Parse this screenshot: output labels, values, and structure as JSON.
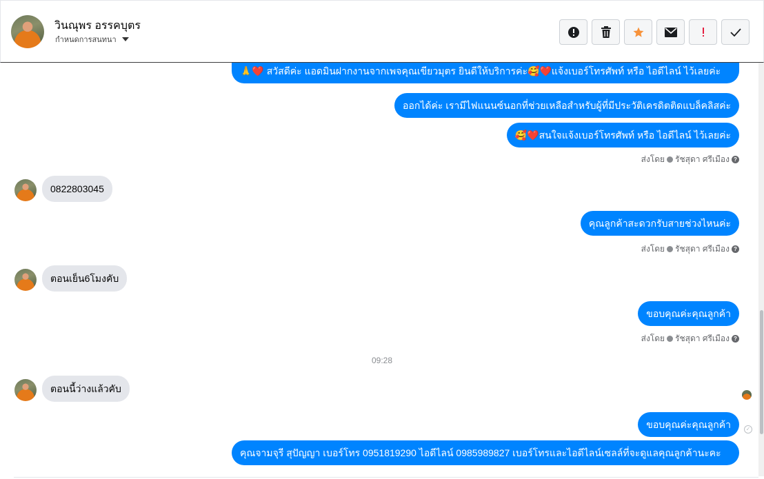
{
  "header": {
    "contact_name": "วินณุพร อรรคบุตร",
    "status_label": "กำหนดการสนทนา",
    "toolbar": [
      {
        "name": "report-button",
        "icon": "exclamation-circle-icon"
      },
      {
        "name": "delete-button",
        "icon": "trash-icon"
      },
      {
        "name": "star-button",
        "icon": "star-icon",
        "color": "#f7923a"
      },
      {
        "name": "email-button",
        "icon": "envelope-icon"
      },
      {
        "name": "important-button",
        "icon": "exclamation-icon",
        "color": "#e41e3f"
      },
      {
        "name": "done-button",
        "icon": "checkmark-icon"
      }
    ]
  },
  "messages": {
    "out_1": "🙏❤️ สวัสดีค่ะ แอดมินฝากงานจากเพจคุณเขียวมุตร ยินดีให้บริการค่ะ🥰❤️แจ้งเบอร์โทรศัพท์ หรือ ไอดีไลน์ ไว้เลยค่ะ",
    "out_2": "ออกได้ค่ะ เรามีไฟแนนซ์นอกที่ช่วยเหลือสำหรับผู้ที่มีประวัติเครดิตติดแบล็คลิสค่ะ",
    "out_3": "🥰❤️สนใจแจ้งเบอร์โทรศัพท์ หรือ ไอดีไลน์ ไว้เลยค่ะ",
    "in_1": "0822803045",
    "out_4": "คุณลูกค้าสะดวกรับสายช่วงไหนค่ะ",
    "in_2": "ตอนเย็น6โมงคับ",
    "out_5": "ขอบคุณค่ะคุณลูกค้า",
    "time_sep": "09:28",
    "in_3": "ตอนนี้ว่างแล้วคับ",
    "out_6": "ขอบคุณค่ะคุณลูกค้า",
    "out_7": "คุณจามจุรี สุปัญญา เบอร์โทร 0951819290 ไอดีไลน์ 0985989827 เบอร์โทรและไอดีไลน์เซลล์ที่จะดูแลคุณลูกค้านะคะ"
  },
  "sent_by": {
    "prefix": "ส่งโดย",
    "agent": "รัชสุดา ศรีเมือง"
  }
}
